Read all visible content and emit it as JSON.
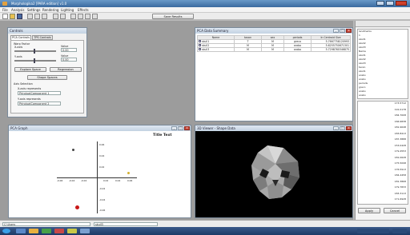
{
  "app": {
    "title": "Morphologika2 [PARA edition] v1.0",
    "menu": [
      "File",
      "Analysis",
      "Settings",
      "Rendering",
      "Lighting",
      "Effects"
    ],
    "save_results": "Save Results"
  },
  "controls": {
    "title": "Controls",
    "tabs": [
      "PCA Controls",
      "TPS Controls"
    ],
    "warp_factor_label": "Warp Factor",
    "x_axis_label": "X-axis",
    "y_axis_label": "Y-axis",
    "value_label": "Value",
    "x_value": "0.00",
    "y_value": "0.00",
    "explore_space": "Explore Space",
    "regression": "Regression",
    "shape_spaces": "Shape Spaces",
    "axis_selection": "Axis Selection",
    "x_axis_represents": "X-axis represents",
    "x_axis_value": "PrincipalComponent 1",
    "y_axis_represents": "Y-axis represents",
    "y_axis_value": "PrincipalComponent 2"
  },
  "summary": {
    "title": "PCA Data Summary",
    "columns": [
      "Name",
      "taxon",
      "sex",
      "periods",
      "In Centroid Size"
    ],
    "rows": [
      {
        "name": "skull1",
        "taxon": "T",
        "sex": "M",
        "periods": "greco",
        "size": "5.7667758120993"
      },
      {
        "name": "skull2",
        "taxon": "M",
        "sex": "M",
        "periods": "arabo",
        "size": "5.6255750671301"
      },
      {
        "name": "skull3",
        "taxon": "M",
        "sex": "M",
        "periods": "arabo",
        "size": "5.7298760346875"
      }
    ]
  },
  "plot": {
    "title": "PCA Graph",
    "text": "Title Text",
    "x_ticks": [
      "-0.06",
      "-0.04",
      "-0.02",
      "0.02",
      "0.04",
      "0.06"
    ],
    "y_ticks": [
      "0.06",
      "0.04",
      "0.02",
      "-0.02",
      "-0.04",
      "-0.06"
    ]
  },
  "viewer": {
    "title": "3D Viewer - Shape Data"
  },
  "right_panel": {
    "entries": [
      "landmarks",
      "1",
      "skull1",
      "skull2",
      "skull3",
      "Name",
      "skull1",
      "skull2",
      "skull3",
      "taxon",
      "skull1",
      "arabo",
      "arabo",
      "periods",
      "greco",
      "arabo",
      "arabo"
    ],
    "numbers": [
      "173.5712",
      "191.0178",
      "184.7008",
      "166.9838",
      "181.9648",
      "183.8413",
      "187.3888",
      "153.0428",
      "179.4553",
      "181.0628",
      "175.5098",
      "176.5913",
      "184.4458",
      "181.3868",
      "179.7833",
      "183.3113",
      "171.6928"
    ],
    "apply_label": "Apply",
    "cancel_label": "Cancel"
  },
  "statusbar": {
    "left": "C:\\Users",
    "file": "skull3"
  }
}
